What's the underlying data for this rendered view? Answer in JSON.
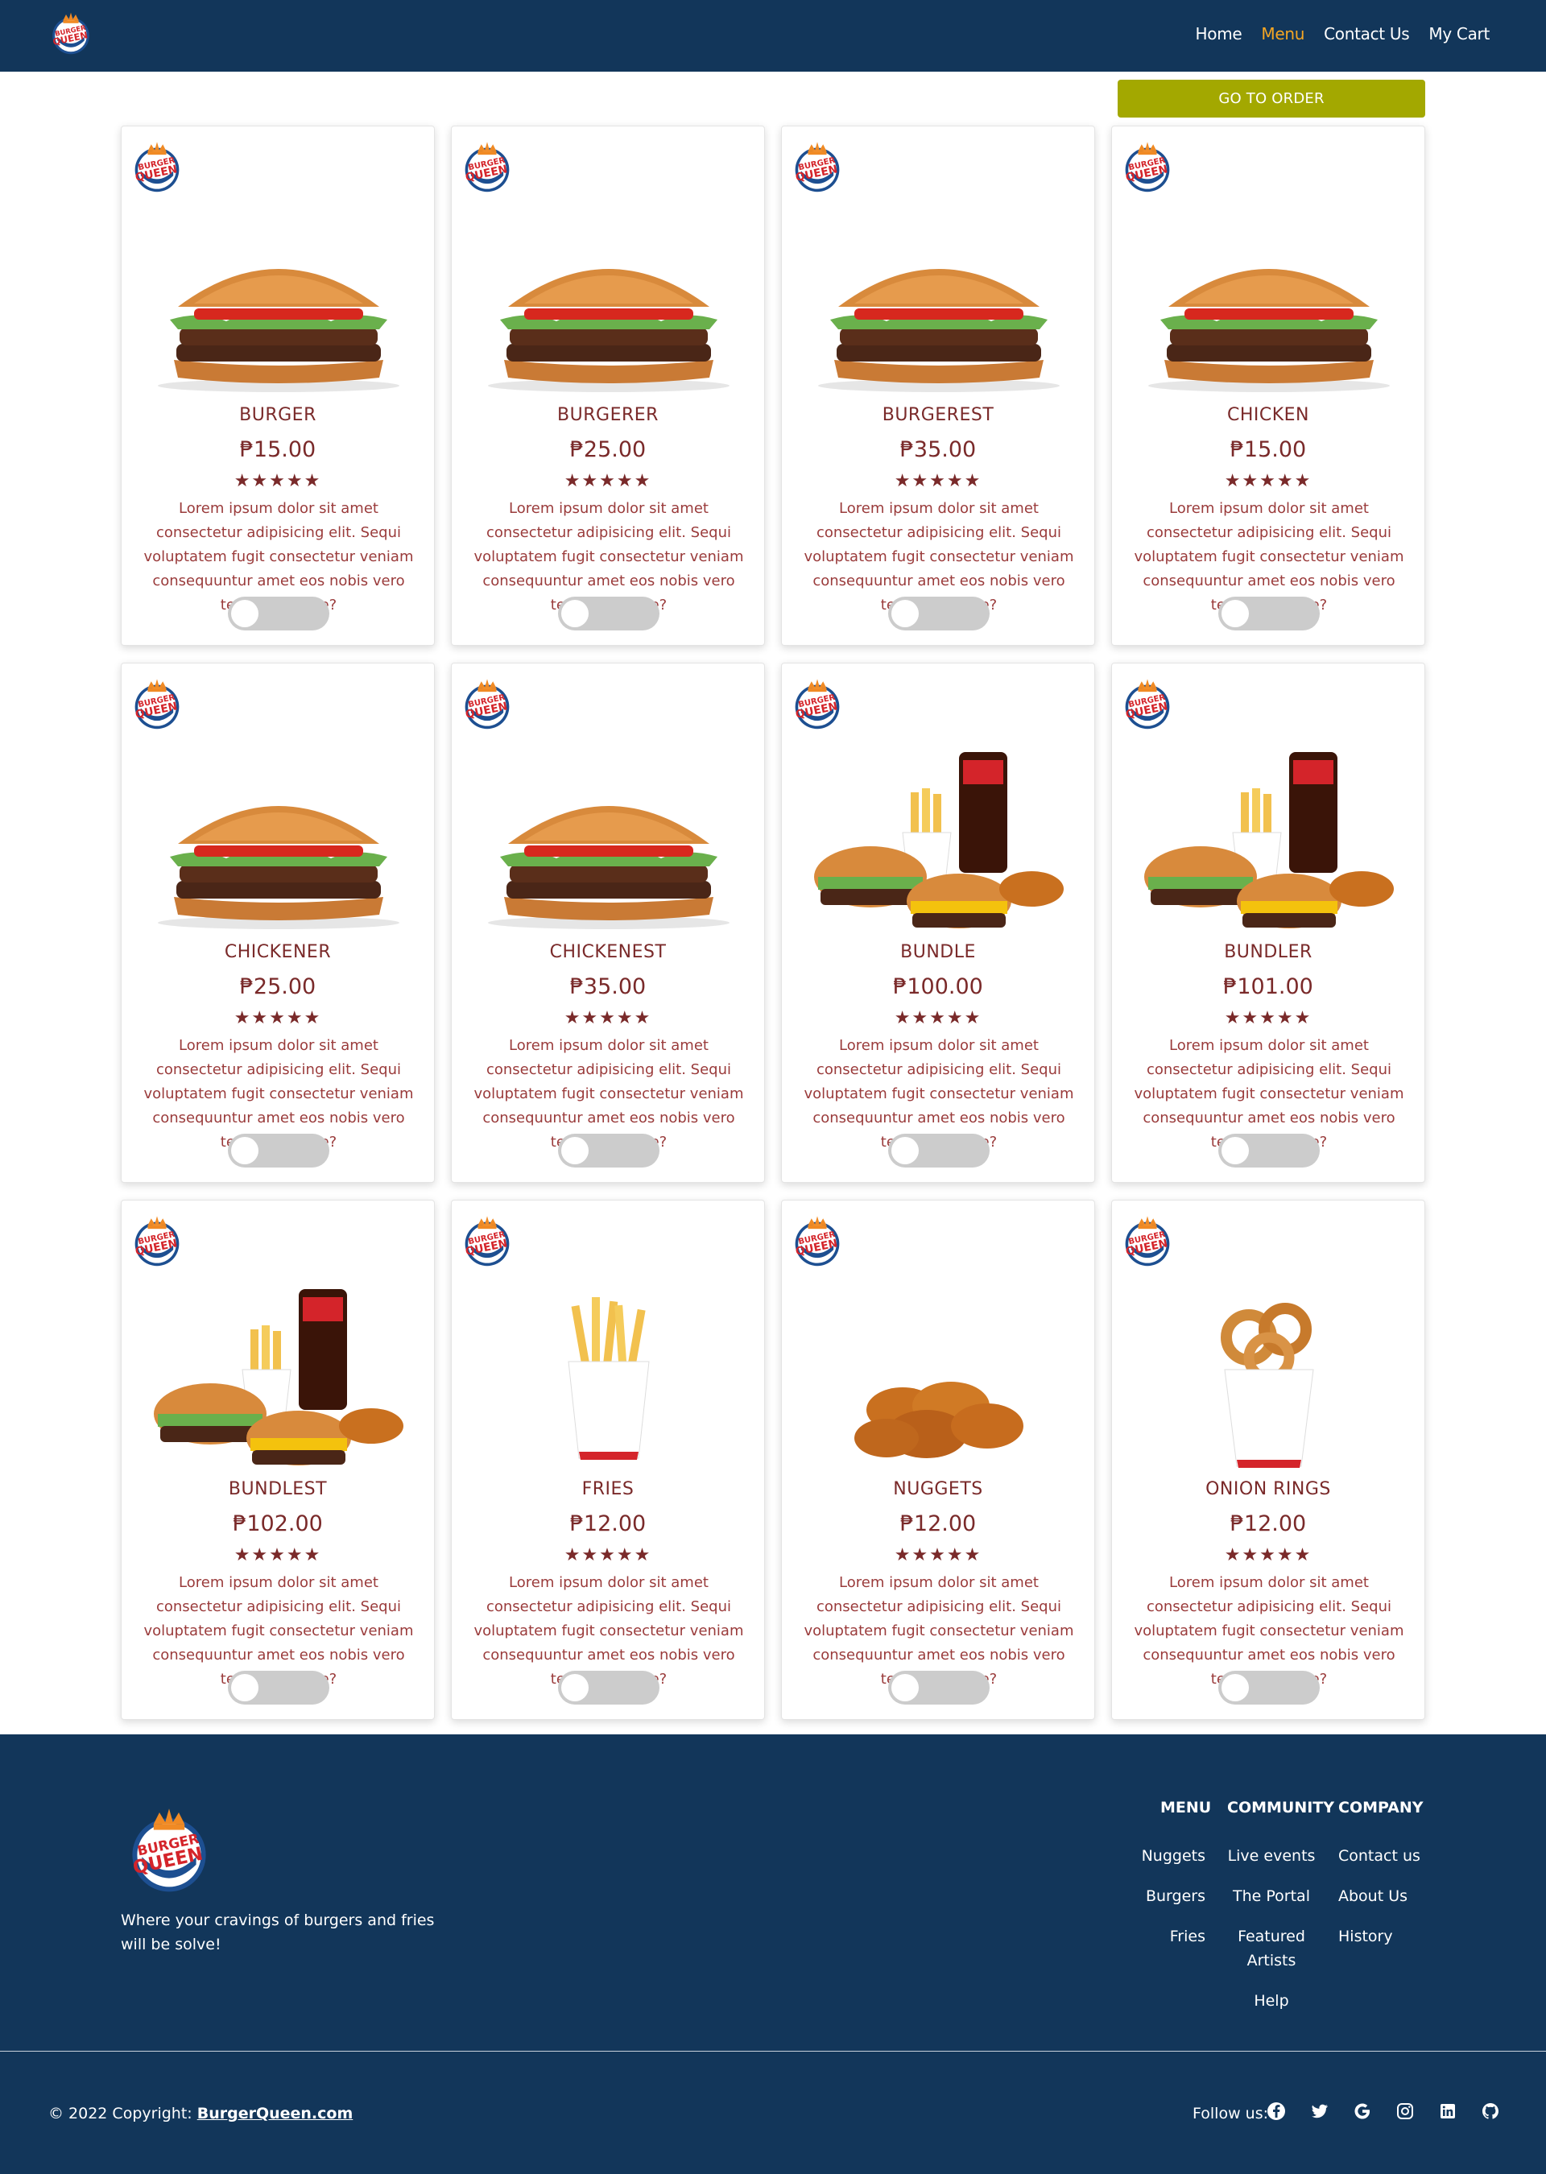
{
  "nav": {
    "links": [
      "Home",
      "Menu",
      "Contact Us",
      "My Cart"
    ],
    "active_index": 1,
    "active_color": "#f5a623"
  },
  "order_button": "GO TO ORDER",
  "products": [
    {
      "name": "BURGER",
      "price": "₱15.00",
      "image": "burger",
      "rating": 5
    },
    {
      "name": "BURGERER",
      "price": "₱25.00",
      "image": "cheeseburger",
      "rating": 5
    },
    {
      "name": "BURGEREST",
      "price": "₱35.00",
      "image": "double-burger",
      "rating": 5
    },
    {
      "name": "CHICKEN",
      "price": "₱15.00",
      "image": "chicken-sandwich",
      "rating": 5
    },
    {
      "name": "CHICKENER",
      "price": "₱25.00",
      "image": "chicken-cheese-sandwich",
      "rating": 5
    },
    {
      "name": "CHICKENEST",
      "price": "₱35.00",
      "image": "chicken-bacon-sandwich",
      "rating": 5
    },
    {
      "name": "BUNDLE",
      "price": "₱100.00",
      "image": "bundle",
      "rating": 5
    },
    {
      "name": "BUNDLER",
      "price": "₱101.00",
      "image": "bundle-chicken",
      "rating": 5
    },
    {
      "name": "BUNDLEST",
      "price": "₱102.00",
      "image": "big-bundle",
      "rating": 5
    },
    {
      "name": "FRIES",
      "price": "₱12.00",
      "image": "fries",
      "rating": 5
    },
    {
      "name": "NUGGETS",
      "price": "₱12.00",
      "image": "nuggets",
      "rating": 5
    },
    {
      "name": "ONION RINGS",
      "price": "₱12.00",
      "image": "onion-rings",
      "rating": 5
    }
  ],
  "product_description": "Lorem ipsum dolor sit amet consectetur adipisicing elit. Sequi voluptatem fugit consectetur veniam consequuntur amet eos nobis vero tenetur beatae?",
  "stars": "★★★★★",
  "footer": {
    "tagline": "Where your cravings of burgers and fries will be solve!",
    "menu": {
      "heading": "MENU",
      "links": [
        "Nuggets",
        "Burgers",
        "Fries"
      ]
    },
    "community": {
      "heading": "COMMUNITY",
      "links": [
        "Live events",
        "The Portal",
        "Featured Artists",
        "Help"
      ]
    },
    "company": {
      "heading": "COMPANY",
      "links": [
        "Contact us",
        "About Us",
        "History"
      ]
    },
    "copyright_prefix": "© 2022 Copyright: ",
    "copyright_link": "BurgerQueen.com",
    "follow_label": "Follow us:",
    "social_icons": [
      "facebook-icon",
      "twitter-icon",
      "google-icon",
      "instagram-icon",
      "linkedin-icon",
      "github-icon"
    ]
  },
  "colors": {
    "navbar": "#12365a",
    "order_button": "#a3a800",
    "product_text": "#7a2a2a",
    "toggle_off": "#cccccc"
  }
}
